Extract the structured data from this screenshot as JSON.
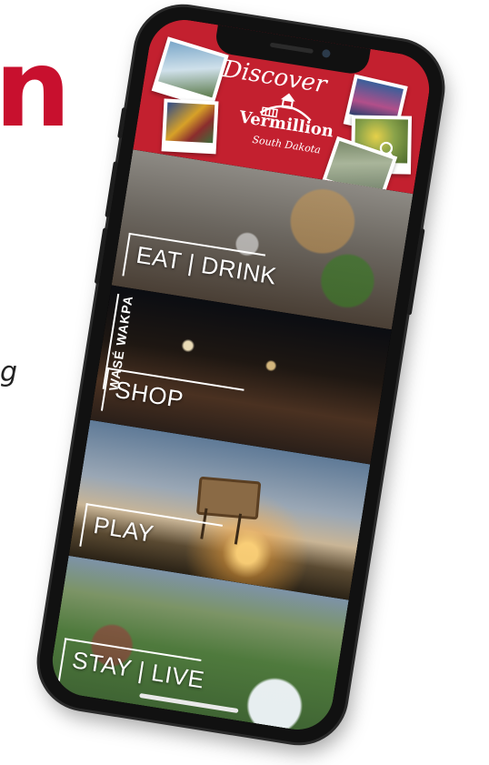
{
  "page": {
    "brand_fragment": "n",
    "tag_fragment": "g",
    "brand_color": "#c8102e"
  },
  "app": {
    "header": {
      "discover_text": "Discover",
      "city": "Vermillion",
      "state": "South Dakota",
      "header_color": "#c3202f",
      "icon": "magnifier-icon"
    },
    "tiles": [
      {
        "label": "EAT | DRINK"
      },
      {
        "label": "SHOP",
        "vertical_label": "WASÉ WAKPA"
      },
      {
        "label": "PLAY"
      },
      {
        "label": "STAY | LIVE"
      }
    ]
  }
}
